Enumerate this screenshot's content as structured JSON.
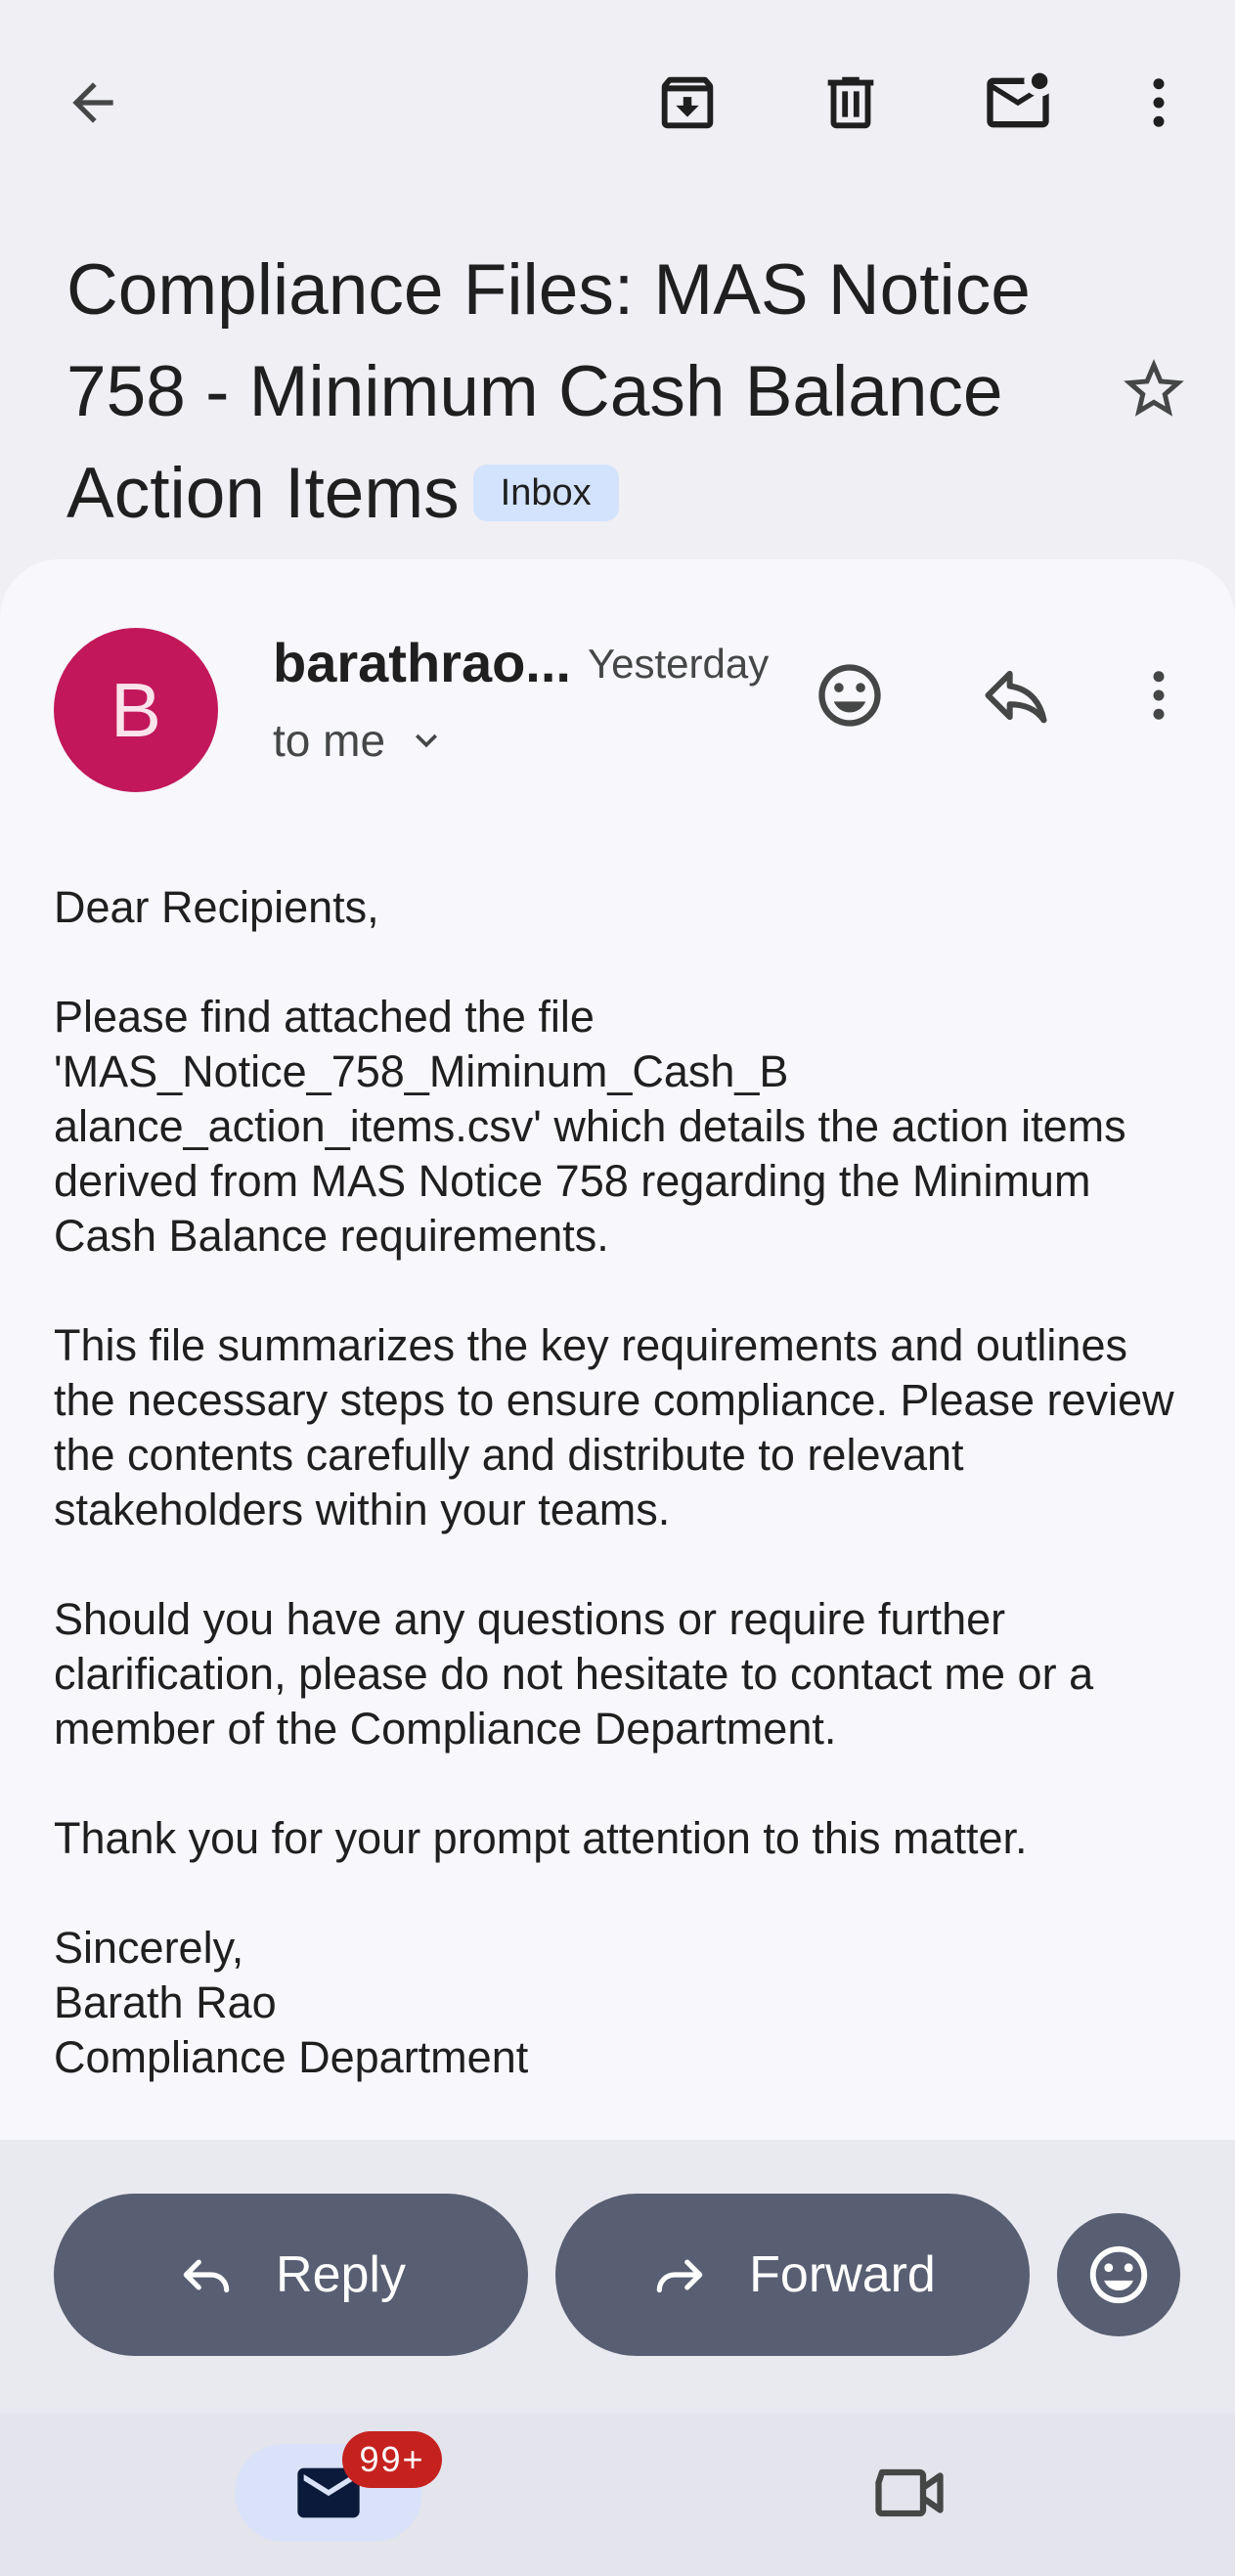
{
  "toolbar": {
    "back_icon": "arrow-left-icon",
    "archive_icon": "archive-icon",
    "delete_icon": "trash-icon",
    "mark_unread_icon": "mail-unread-icon",
    "more_icon": "more-vert-icon"
  },
  "email": {
    "subject": "Compliance Files: MAS Notice 758 - Minimum Cash Balance Action Items",
    "label": "Inbox",
    "starred": false,
    "sender_initial": "B",
    "sender_name": "barathrao...",
    "date": "Yesterday",
    "recipient": "to me",
    "avatar_color": "#c2185b",
    "body": "Dear Recipients,\n\nPlease find attached the file 'MAS_Notice_758_Miminum_Cash_B\nalance_action_items.csv' which details the action items derived from MAS Notice 758 regarding the Minimum Cash Balance requirements.\n\nThis file summarizes the key requirements and outlines the necessary steps to ensure compliance. Please review the contents carefully and distribute to relevant stakeholders within your teams.\n\nShould you have any questions or require further clarification, please do not hesitate to contact me or a member of the Compliance Department.\n\nThank you for your prompt attention to this matter.\n\nSincerely,\nBarath Rao\nCompliance Department"
  },
  "actions": {
    "reply_label": "Reply",
    "forward_label": "Forward"
  },
  "bottom_nav": {
    "mail_badge": "99+"
  },
  "colors": {
    "accent_pill": "#585f72",
    "badge": "#c5221f",
    "chip": "#d3e3fd"
  }
}
